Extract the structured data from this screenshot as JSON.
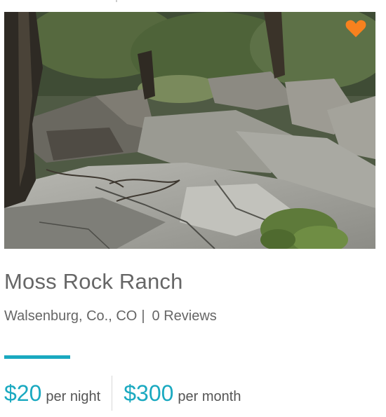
{
  "listing": {
    "name": "Moss Rock Ranch",
    "location": "Walsenburg, Co., CO",
    "separator": "|",
    "reviews": "0 Reviews",
    "photo_alt": "Rocky creek bed with trees",
    "favorite_icon": "heart-icon",
    "favorite_color": "#f7811e",
    "accent_color": "#1aa9c0"
  },
  "pricing": {
    "nightly_amount": "$20",
    "nightly_unit": "per night",
    "monthly_amount": "$300",
    "monthly_unit": "per month"
  }
}
